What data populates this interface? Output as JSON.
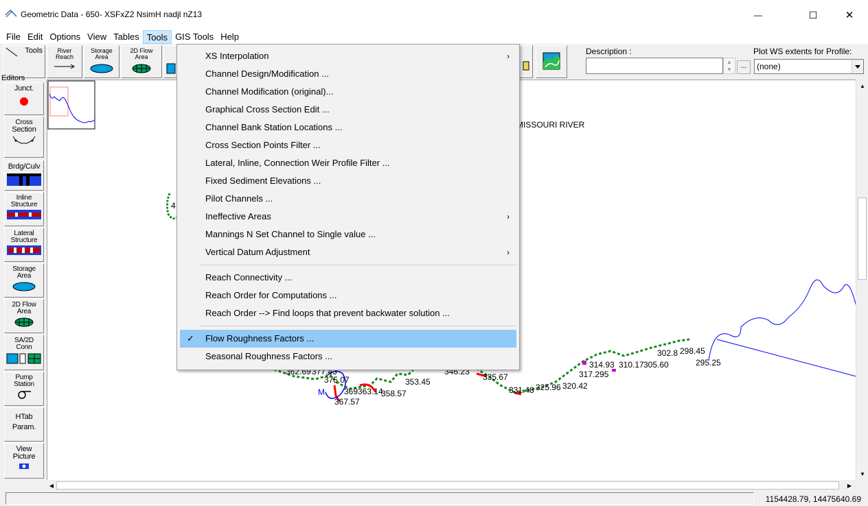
{
  "window": {
    "title": "Geometric Data - 650- XSFxZ2 NsimH nadjl nZ13",
    "minimize": "—",
    "maximize": "☐",
    "close": "✕"
  },
  "menubar": [
    "File",
    "Edit",
    "Options",
    "View",
    "Tables",
    "Tools",
    "GIS Tools",
    "Help"
  ],
  "toolbar": {
    "tools_label": "Tools",
    "river_reach": [
      "River",
      "Reach"
    ],
    "storage_area": [
      "Storage",
      "Area"
    ],
    "flow_area_2d": [
      "2D Flow",
      "Area"
    ],
    "description_label": "Description :",
    "description_value": "",
    "more_button": "...",
    "plot_ws_label": "Plot WS extents for Profile:",
    "plot_ws_value": "(none)"
  },
  "editors": {
    "header": "Editors",
    "buttons": [
      {
        "id": "junct",
        "lines": [
          "Junct."
        ]
      },
      {
        "id": "cross-section",
        "lines": [
          "Cross",
          "Section"
        ]
      },
      {
        "id": "brdg-culv",
        "lines": [
          "Brdg/Culv"
        ]
      },
      {
        "id": "inline-structure",
        "lines": [
          "Inline",
          "Structure"
        ]
      },
      {
        "id": "lateral-structure",
        "lines": [
          "Lateral",
          "Structure"
        ]
      },
      {
        "id": "storage-area",
        "lines": [
          "Storage",
          "Area"
        ]
      },
      {
        "id": "2d-flow-area",
        "lines": [
          "2D Flow",
          "Area"
        ]
      },
      {
        "id": "sa-2d-conn",
        "lines": [
          "SA/2D",
          "Conn"
        ]
      },
      {
        "id": "pump-station",
        "lines": [
          "Pump",
          "Station"
        ]
      },
      {
        "id": "htab-param",
        "lines": [
          "HTab",
          "Param."
        ]
      },
      {
        "id": "view-picture",
        "lines": [
          "View",
          "Picture"
        ]
      }
    ]
  },
  "tools_menu": {
    "items": [
      {
        "label": "XS Interpolation",
        "submenu": true
      },
      {
        "label": "Channel Design/Modification ..."
      },
      {
        "label": "Channel Modification (original)..."
      },
      {
        "label": "Graphical Cross Section Edit ..."
      },
      {
        "label": "Channel Bank Station Locations ..."
      },
      {
        "label": "Cross Section Points Filter ..."
      },
      {
        "label": "Lateral, Inline, Connection Weir Profile Filter ..."
      },
      {
        "label": "Fixed Sediment Elevations ..."
      },
      {
        "label": "Pilot Channels ..."
      },
      {
        "label": "Ineffective Areas",
        "submenu": true
      },
      {
        "label": "Mannings N Set Channel to Single value ..."
      },
      {
        "label": "Vertical Datum Adjustment",
        "submenu": true
      },
      {
        "separator": true
      },
      {
        "label": "Reach Connectivity ..."
      },
      {
        "label": "Reach Order for Computations ..."
      },
      {
        "label": "Reach Order --> Find loops that prevent backwater solution ..."
      },
      {
        "separator": true
      },
      {
        "label": "Flow Roughness Factors ...",
        "checked": true,
        "highlighted": true
      },
      {
        "label": "Seasonal Roughness Factors ..."
      }
    ],
    "submenu_arrow": "›",
    "check_mark": "✓"
  },
  "canvas": {
    "river_name": "MISSOURI RIVER",
    "station_labels": [
      {
        "text": "298.45"
      },
      {
        "text": "302.8"
      },
      {
        "text": "295.25"
      },
      {
        "text": "314.93"
      },
      {
        "text": "310.17"
      },
      {
        "text": "305.60"
      },
      {
        "text": "317.295"
      },
      {
        "text": "320.42"
      },
      {
        "text": "325.96"
      },
      {
        "text": "331.48"
      },
      {
        "text": "335.67"
      },
      {
        "text": "353.45"
      },
      {
        "text": "358.57"
      },
      {
        "text": "375.07"
      },
      {
        "text": "367.57"
      },
      {
        "text": "362.69"
      },
      {
        "text": "377.43"
      },
      {
        "text": "369"
      },
      {
        "text": "363.14"
      },
      {
        "text": "346.23"
      },
      {
        "text": "M"
      },
      {
        "text": "4"
      }
    ],
    "colors": {
      "river": "#0000ff",
      "xs": "#008000",
      "structure": "#ff0000",
      "lateral": "#cc00cc"
    }
  },
  "status": {
    "coordinates": "1154428.79, 14475640.69"
  }
}
